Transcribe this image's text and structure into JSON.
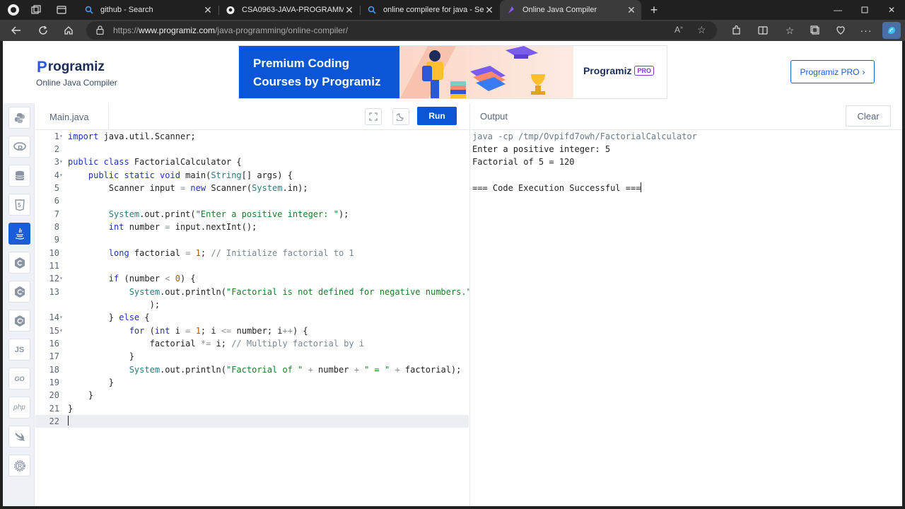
{
  "browser": {
    "tabs": [
      {
        "title": "github - Search",
        "active": false
      },
      {
        "title": "CSA0963-JAVA-PROGRAMMING",
        "active": false
      },
      {
        "title": "online compilere for java - Search",
        "active": false
      },
      {
        "title": "Online Java Compiler",
        "active": true
      }
    ],
    "url_prefix": "https://",
    "url_host": "www.programiz.com",
    "url_path": "/java-programming/online-compiler/"
  },
  "header": {
    "logo_text": "rogramiz",
    "logo_mark": "P",
    "subtitle": "Online Java Compiler",
    "banner_line1": "Premium Coding",
    "banner_line2": "Courses by Programiz",
    "banner_logo": "Programiz",
    "banner_pro": "PRO",
    "pro_button": "Programiz PRO"
  },
  "sidebar": {
    "languages": [
      "python",
      "r",
      "sql",
      "html",
      "java",
      "c",
      "cpp",
      "csharp",
      "javascript",
      "go",
      "php",
      "swift",
      "rust"
    ],
    "active": "java",
    "js_label": "JS",
    "go_label": "GO",
    "php_label": "php"
  },
  "editor": {
    "file_name": "Main.java",
    "run_label": "Run",
    "current_line": 22
  },
  "output": {
    "title": "Output",
    "clear_label": "Clear",
    "lines": [
      "java -cp /tmp/Ovpifd7owh/FactorialCalculator",
      "Enter a positive integer: 5",
      "Factorial of 5 = 120",
      "",
      "=== Code Execution Successful ==="
    ]
  },
  "colors": {
    "brand_blue": "#0a56d6",
    "sidebar_bg": "#eef1f6"
  }
}
